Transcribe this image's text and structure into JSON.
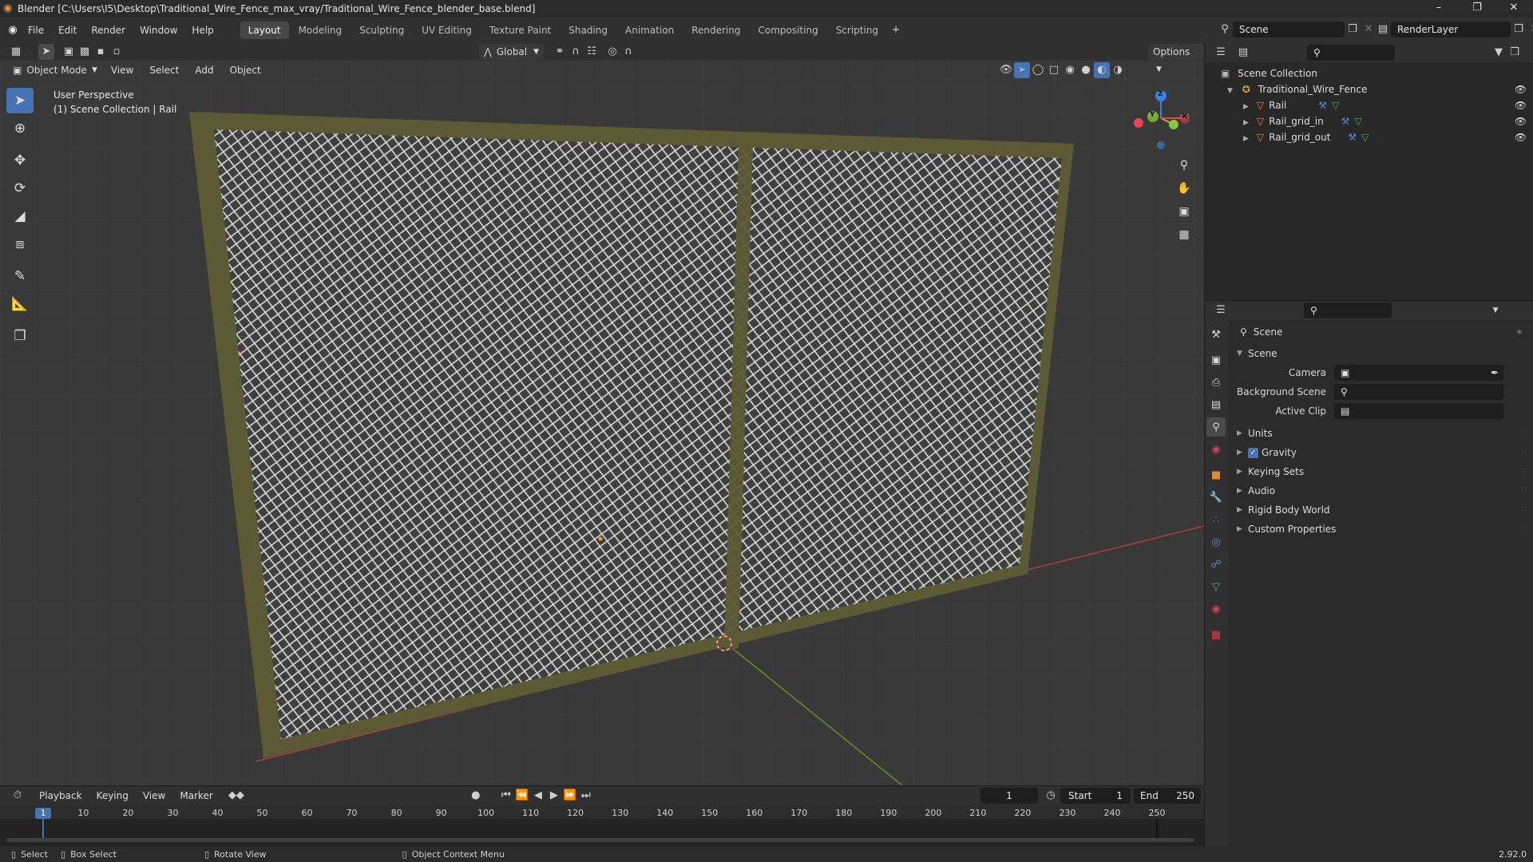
{
  "window": {
    "title": "Blender [C:\\Users\\I5\\Desktop\\Traditional_Wire_Fence_max_vray/Traditional_Wire_Fence_blender_base.blend]",
    "minimize": "–",
    "maximize": "❐",
    "close": "✕"
  },
  "menu": [
    "File",
    "Edit",
    "Render",
    "Window",
    "Help"
  ],
  "workspaces": [
    "Layout",
    "Modeling",
    "Sculpting",
    "UV Editing",
    "Texture Paint",
    "Shading",
    "Animation",
    "Rendering",
    "Compositing",
    "Scripting"
  ],
  "add_workspace": "+",
  "scene_field": "Scene",
  "renderlayer_field": "RenderLayer",
  "tool_header": {
    "transform_orientation": "Global",
    "options": "Options"
  },
  "viewport_header": {
    "mode": "Object Mode",
    "menus": [
      "View",
      "Select",
      "Add",
      "Object"
    ]
  },
  "viewport": {
    "perspective": "User Perspective",
    "collection": "(1) Scene Collection | Rail",
    "gizmo": {
      "z": "Z",
      "y": "Y",
      "x": "X"
    }
  },
  "outliner": {
    "root": "Scene Collection",
    "collection": "Traditional_Wire_Fence",
    "objects": [
      "Rail",
      "Rail_grid_in",
      "Rail_grid_out"
    ]
  },
  "properties": {
    "context": "Scene",
    "panel_title": "Scene",
    "fields": [
      {
        "label": "Camera",
        "value": ""
      },
      {
        "label": "Background Scene",
        "value": ""
      },
      {
        "label": "Active Clip",
        "value": ""
      }
    ],
    "panels": [
      "Units",
      "Gravity",
      "Keying Sets",
      "Audio",
      "Rigid Body World",
      "Custom Properties"
    ],
    "gravity_checked": true
  },
  "timeline": {
    "menus": [
      "Playback",
      "Keying",
      "View",
      "Marker"
    ],
    "current_frame": "1",
    "start_label": "Start",
    "start": "1",
    "end_label": "End",
    "end": "250",
    "ticks": [
      "1",
      "10",
      "20",
      "30",
      "40",
      "50",
      "60",
      "70",
      "80",
      "90",
      "100",
      "110",
      "120",
      "130",
      "140",
      "150",
      "160",
      "170",
      "180",
      "190",
      "200",
      "210",
      "220",
      "230",
      "240",
      "250"
    ]
  },
  "statusbar": {
    "select": "Select",
    "box_select": "Box Select",
    "rotate": "Rotate View",
    "context_menu": "Object Context Menu",
    "version": "2.92.0"
  },
  "colors": {
    "accent": "#4772b3",
    "frame": "#5c5a34",
    "x_axis": "#b8403f",
    "y_axis": "#6e9a2c",
    "gizmo_z": "#3b82d6",
    "gizmo_y": "#8bc43f",
    "gizmo_x": "#e8454f"
  }
}
